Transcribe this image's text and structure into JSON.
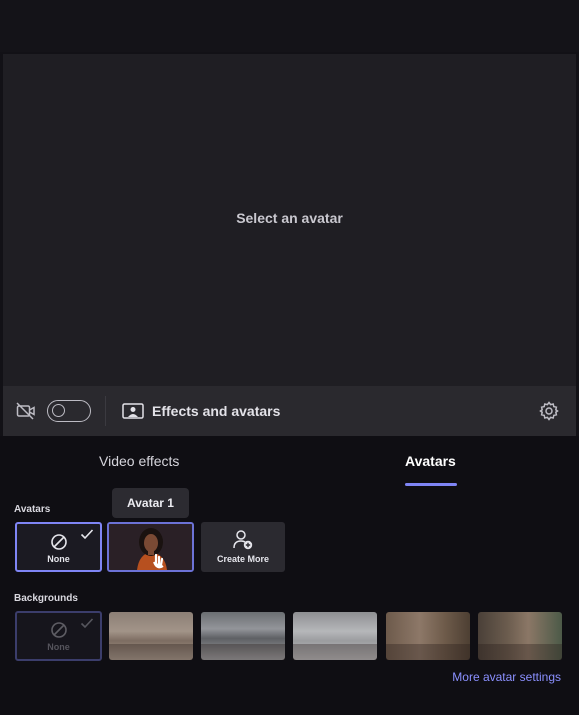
{
  "preview": {
    "message": "Select an avatar"
  },
  "controls": {
    "effects_label": "Effects and avatars"
  },
  "tabs": [
    {
      "label": "Video effects",
      "selected": false
    },
    {
      "label": "Avatars",
      "selected": true
    }
  ],
  "avatars": {
    "section_label": "Avatars",
    "tooltip": "Avatar 1",
    "none_label": "None",
    "create_label": "Create More"
  },
  "backgrounds": {
    "section_label": "Backgrounds",
    "none_label": "None"
  },
  "footer": {
    "link": "More avatar settings"
  },
  "colors": {
    "accent": "#7f85f5",
    "link": "#8b90ff"
  }
}
